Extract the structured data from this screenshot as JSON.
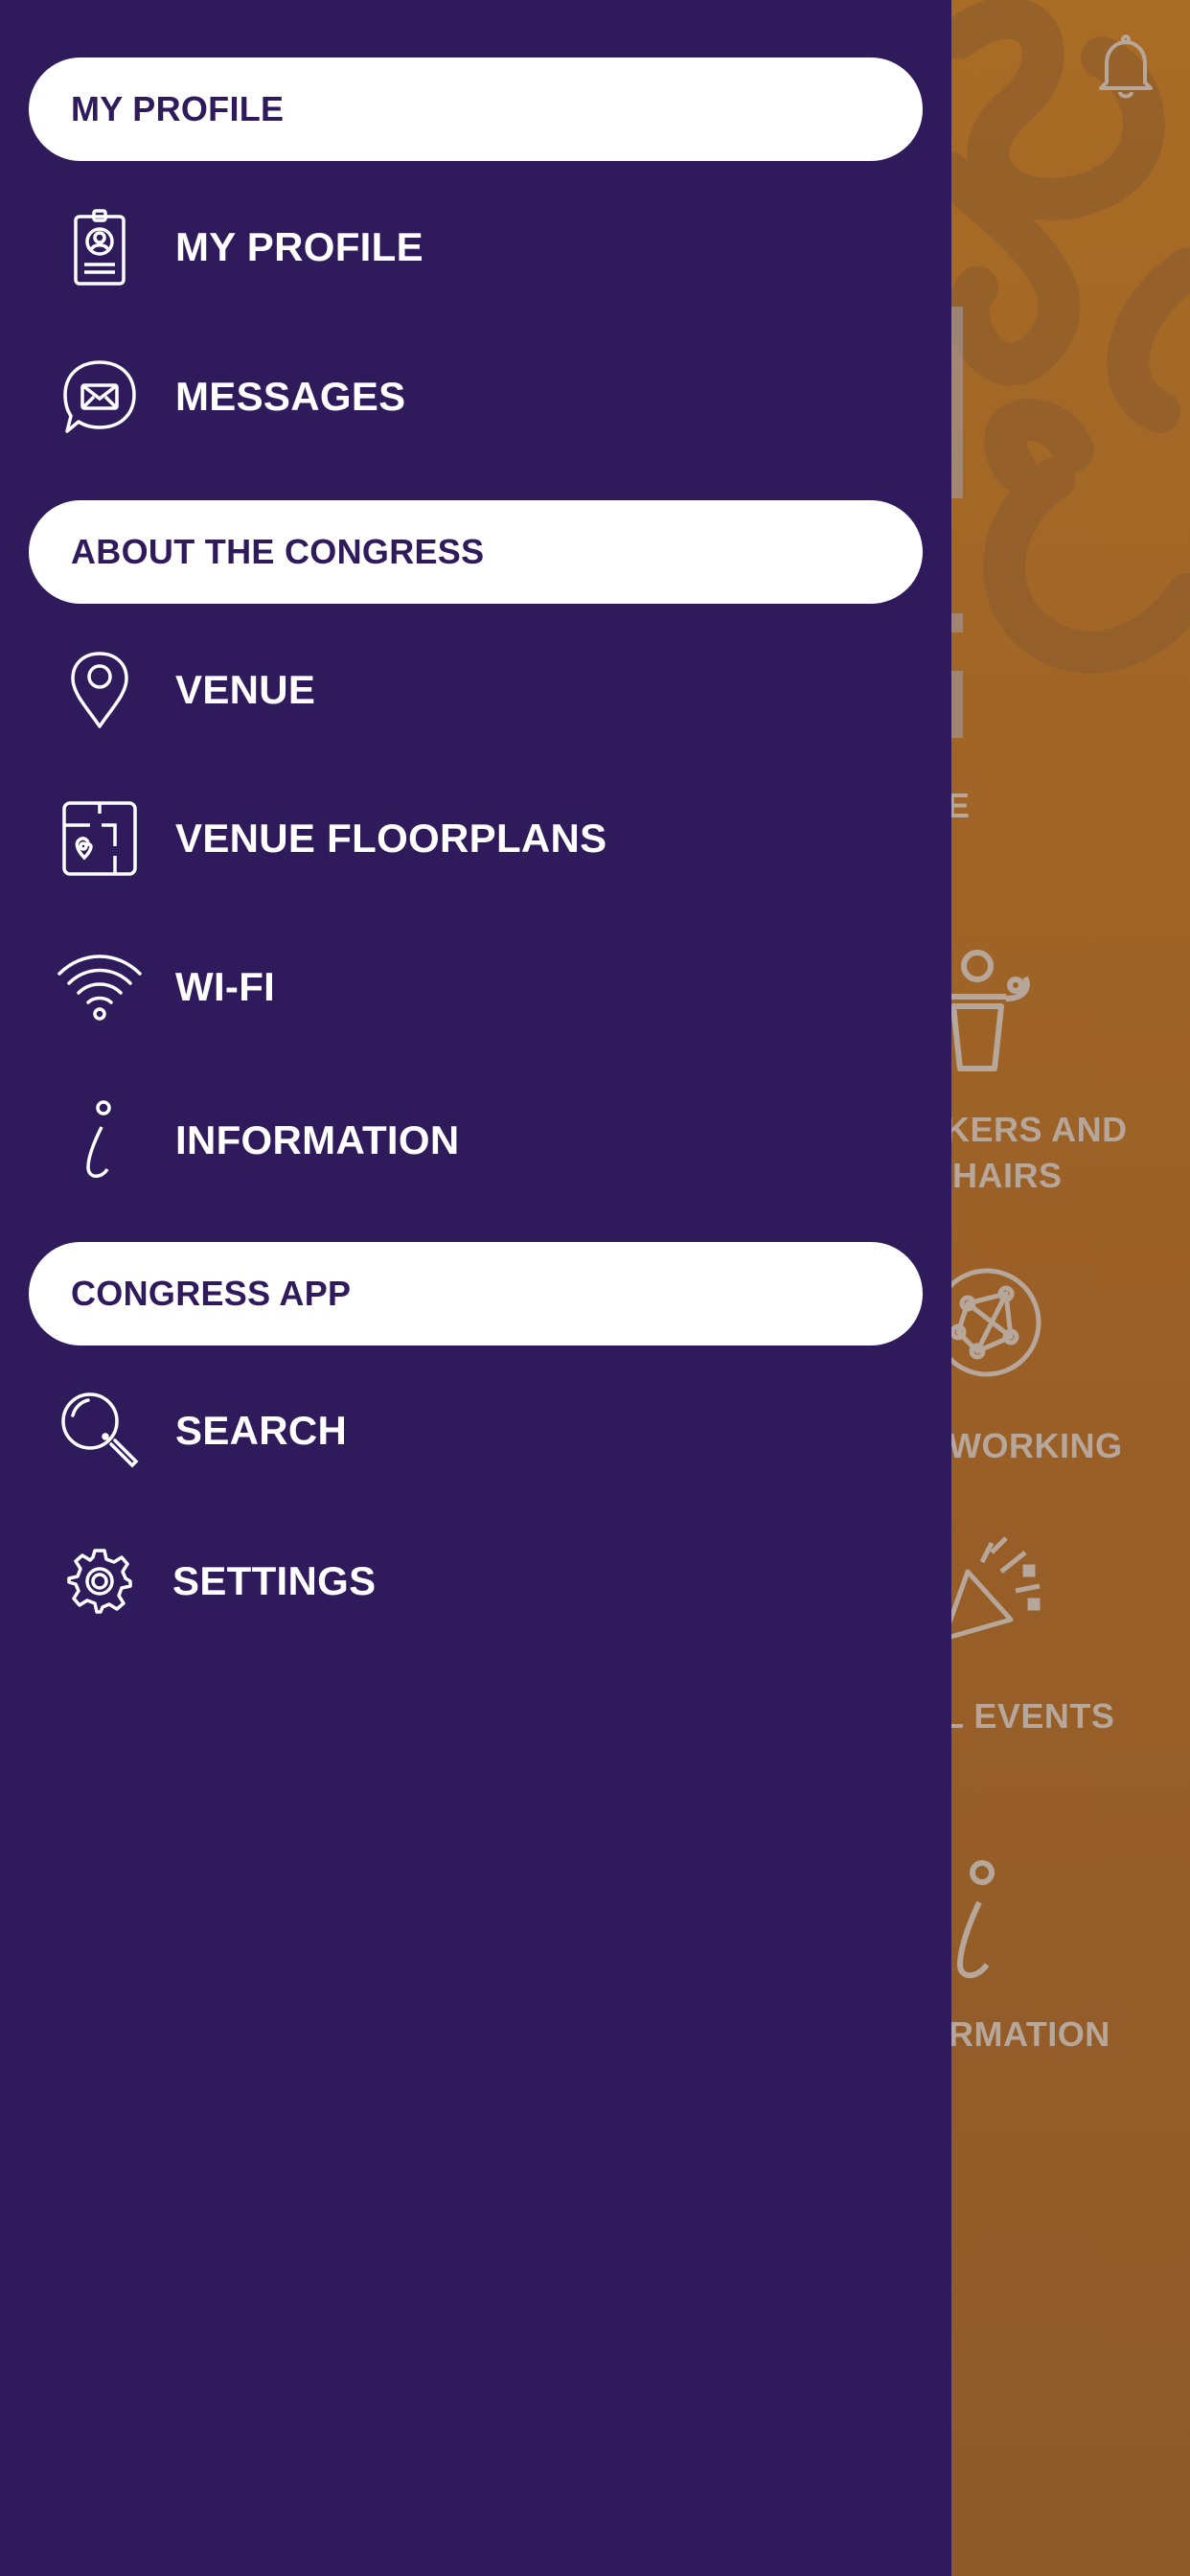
{
  "background_app": {
    "labels": {
      "speakers_line1": "KERS AND",
      "speakers_line2": "HAIRS",
      "networking": "WORKING",
      "social_events": "L EVENTS",
      "information": "RMATION",
      "partial_e": "E"
    },
    "icons": [
      "bell-icon",
      "speaker-icon",
      "network-icon",
      "party-popper-icon",
      "info-icon"
    ]
  },
  "drawer": {
    "sections": [
      {
        "header": "MY PROFILE",
        "items": [
          {
            "label": "MY PROFILE",
            "icon": "id-badge-icon"
          },
          {
            "label": "MESSAGES",
            "icon": "message-bubble-icon"
          }
        ]
      },
      {
        "header": "ABOUT THE CONGRESS",
        "items": [
          {
            "label": "VENUE",
            "icon": "map-pin-icon"
          },
          {
            "label": "VENUE FLOORPLANS",
            "icon": "floorplan-icon"
          },
          {
            "label": "WI-FI",
            "icon": "wifi-icon"
          },
          {
            "label": "INFORMATION",
            "icon": "info-icon"
          }
        ]
      },
      {
        "header": "CONGRESS APP",
        "items": [
          {
            "label": "SEARCH",
            "icon": "search-icon"
          },
          {
            "label": "SETTINGS",
            "icon": "gear-icon"
          }
        ]
      }
    ]
  },
  "colors": {
    "drawer_bg": "#2f1a5c",
    "header_bg": "#ffffff",
    "header_text": "#2f1a5c",
    "item_text": "#ffffff",
    "background_orange": "#9a6228"
  }
}
